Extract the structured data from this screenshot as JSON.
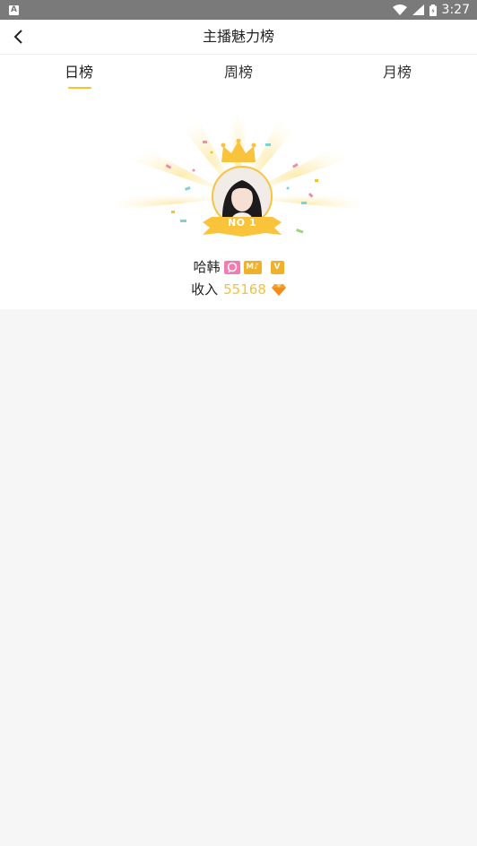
{
  "statusbar": {
    "time": "3:27"
  },
  "header": {
    "title": "主播魅力榜"
  },
  "tabs": [
    {
      "label": "日榜",
      "active": true
    },
    {
      "label": "周榜",
      "active": false
    },
    {
      "label": "月榜",
      "active": false
    }
  ],
  "top": {
    "rank_label": "NO 1",
    "name": "哈韩",
    "income_label": "收入",
    "income_value": "55168"
  },
  "colors": {
    "accent": "#f7c423",
    "income": "#f3c23a",
    "statusbar": "#7a7a7a"
  },
  "icons": [
    "back-icon",
    "wifi-icon",
    "signal-icon",
    "battery-icon",
    "crown-icon",
    "diamond-icon"
  ]
}
